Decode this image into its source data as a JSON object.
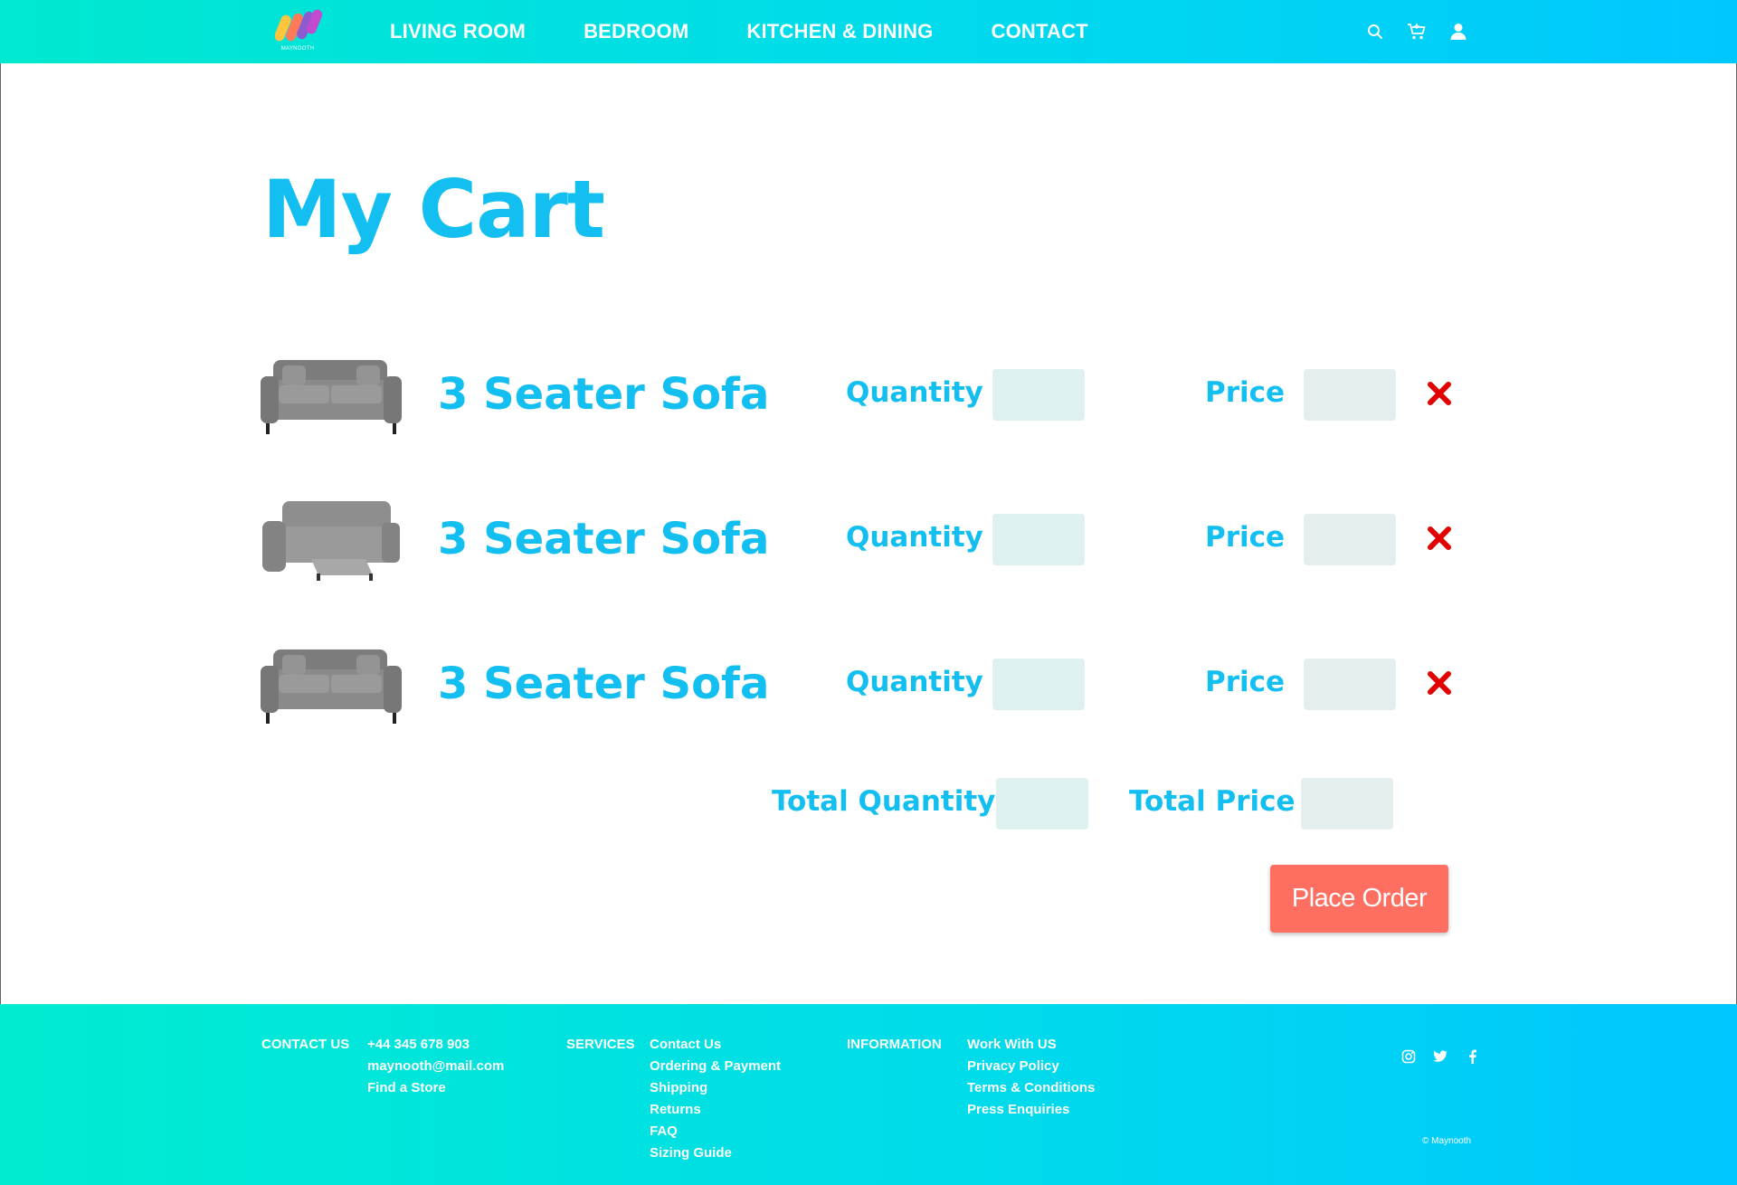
{
  "header": {
    "logo_text": "MAYNOOTH",
    "nav": [
      "LIVING ROOM",
      "BEDROOM",
      "KITCHEN & DINING",
      "CONTACT"
    ],
    "icons": [
      "search-icon",
      "cart-icon",
      "user-icon"
    ]
  },
  "page_title": "My Cart",
  "cart": {
    "items": [
      {
        "name": "3 Seater Sofa",
        "quantity_label": "Quantity",
        "price_label": "Price",
        "quantity": "",
        "price": "",
        "image": "sofa-image"
      },
      {
        "name": "3 Seater Sofa",
        "quantity_label": "Quantity",
        "price_label": "Price",
        "quantity": "",
        "price": "",
        "image": "recliner-sofa-image"
      },
      {
        "name": "3 Seater Sofa",
        "quantity_label": "Quantity",
        "price_label": "Price",
        "quantity": "",
        "price": "",
        "image": "sofa-image"
      }
    ],
    "total_quantity_label": "Total Quantity",
    "total_price_label": "Total Price",
    "total_quantity": "",
    "total_price": "",
    "order_button": "Place Order"
  },
  "footer": {
    "contact": {
      "heading": "CONTACT US",
      "items": [
        "+44 345 678 903",
        "maynooth@mail.com",
        "Find a Store"
      ]
    },
    "services": {
      "heading": "SERVICES",
      "items": [
        "Contact Us",
        "Ordering & Payment",
        "Shipping",
        "Returns",
        "FAQ",
        "Sizing Guide"
      ]
    },
    "information": {
      "heading": "INFORMATION",
      "items": [
        "Work With US",
        "Privacy Policy",
        "Terms & Conditions",
        "Press Enquiries"
      ]
    },
    "social": [
      "instagram-icon",
      "twitter-icon",
      "facebook-icon"
    ],
    "copyright": "© Maynooth"
  },
  "colors": {
    "accent": "#12bff0",
    "header_gradient_start": "#00e8cf",
    "header_gradient_end": "#00c8ff",
    "order_button": "#ff6f61",
    "remove_icon": "#e00000",
    "input_bg": "#dff0f0"
  }
}
